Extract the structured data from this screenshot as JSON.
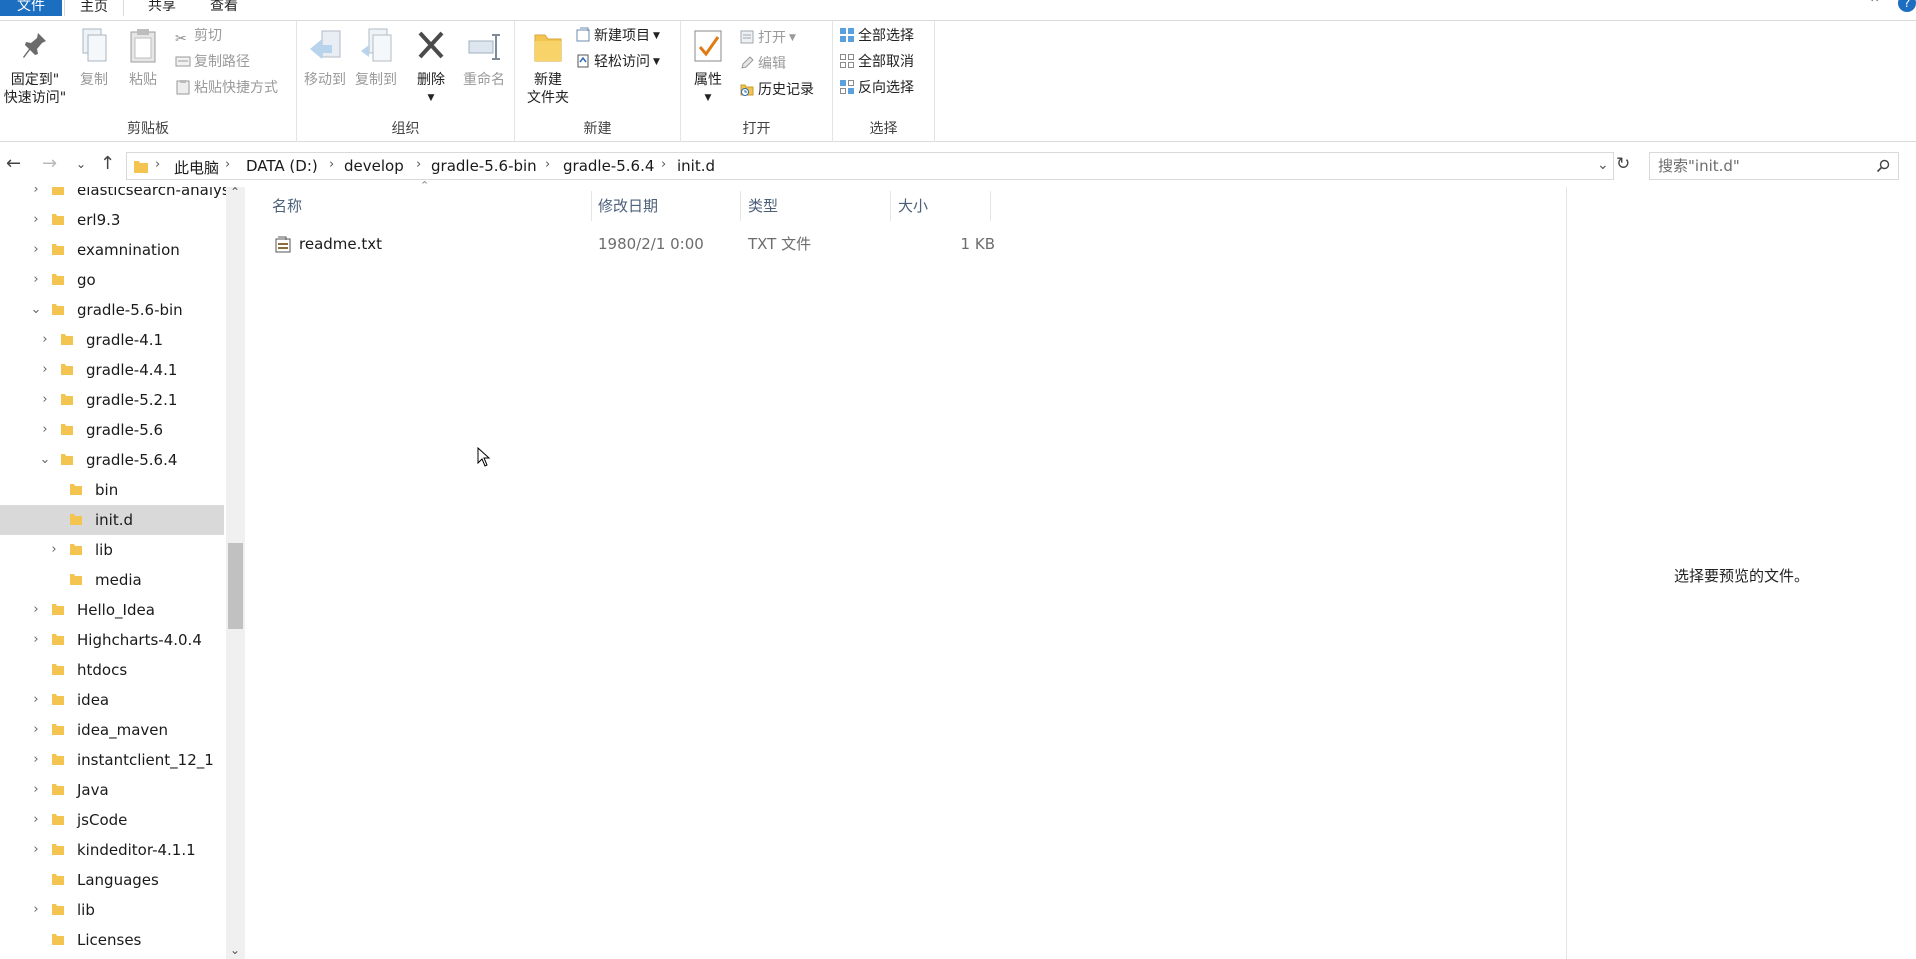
{
  "tabs": {
    "file": "文件",
    "home": "主页",
    "share": "共享",
    "view": "查看"
  },
  "ribbon": {
    "clipboard": {
      "label": "剪贴板",
      "pin_line1": "固定到\"",
      "pin_line2": "快速访问\"",
      "copy": "复制",
      "paste": "粘贴",
      "cut": "剪切",
      "copy_path": "复制路径",
      "paste_shortcut": "粘贴快捷方式"
    },
    "organize": {
      "label": "组织",
      "move_to": "移动到",
      "copy_to": "复制到",
      "delete": "删除",
      "rename": "重命名"
    },
    "new": {
      "label": "新建",
      "new_folder_line1": "新建",
      "new_folder_line2": "文件夹",
      "new_item": "新建项目",
      "easy_access": "轻松访问"
    },
    "open": {
      "label": "打开",
      "properties": "属性",
      "open": "打开",
      "edit": "编辑",
      "history": "历史记录"
    },
    "select": {
      "label": "选择",
      "select_all": "全部选择",
      "select_none": "全部取消",
      "invert": "反向选择"
    }
  },
  "address": {
    "crumbs": [
      "此电脑",
      "DATA (D:)",
      "develop",
      "gradle-5.6-bin",
      "gradle-5.6.4",
      "init.d"
    ]
  },
  "search": {
    "placeholder": "搜索\"init.d\""
  },
  "tree": [
    {
      "label": "elasticsearch-analysi",
      "chevron": "›"
    },
    {
      "label": "erl9.3",
      "chevron": "›"
    },
    {
      "label": "examnination",
      "chevron": "›"
    },
    {
      "label": "go",
      "chevron": "›"
    },
    {
      "label": "gradle-5.6-bin",
      "chevron": "⌄"
    },
    {
      "label": "gradle-4.1",
      "chevron": "›"
    },
    {
      "label": "gradle-4.4.1",
      "chevron": "›"
    },
    {
      "label": "gradle-5.2.1",
      "chevron": "›"
    },
    {
      "label": "gradle-5.6",
      "chevron": "›"
    },
    {
      "label": "gradle-5.6.4",
      "chevron": "⌄"
    },
    {
      "label": "bin",
      "chevron": ""
    },
    {
      "label": "init.d",
      "chevron": ""
    },
    {
      "label": "lib",
      "chevron": "›"
    },
    {
      "label": "media",
      "chevron": ""
    },
    {
      "label": "Hello_Idea",
      "chevron": "›"
    },
    {
      "label": "Highcharts-4.0.4",
      "chevron": "›"
    },
    {
      "label": "htdocs",
      "chevron": ""
    },
    {
      "label": "idea",
      "chevron": "›"
    },
    {
      "label": "idea_maven",
      "chevron": "›"
    },
    {
      "label": "instantclient_12_1",
      "chevron": "›"
    },
    {
      "label": "Java",
      "chevron": "›"
    },
    {
      "label": "jsCode",
      "chevron": "›"
    },
    {
      "label": "kindeditor-4.1.1",
      "chevron": "›"
    },
    {
      "label": "Languages",
      "chevron": ""
    },
    {
      "label": "lib",
      "chevron": "›"
    },
    {
      "label": "Licenses",
      "chevron": ""
    }
  ],
  "columns": {
    "name": "名称",
    "modified": "修改日期",
    "type": "类型",
    "size": "大小"
  },
  "files": [
    {
      "name": "readme.txt",
      "modified": "1980/2/1 0:00",
      "type": "TXT 文件",
      "size": "1 KB"
    }
  ],
  "preview": {
    "message": "选择要预览的文件。"
  },
  "colors": {
    "accent": "#1c6fc0",
    "selected": "#d9d9d9",
    "folder": "#f3c44f",
    "header_text": "#4c607a"
  },
  "icons": [
    "pin-icon",
    "copy-icon",
    "paste-icon",
    "cut-icon",
    "copy-path-icon",
    "paste-shortcut-icon",
    "move-to-icon",
    "copy-to-icon",
    "delete-icon",
    "rename-icon",
    "new-folder-icon",
    "new-item-icon",
    "easy-access-icon",
    "properties-icon",
    "open-icon",
    "edit-icon",
    "history-icon",
    "select-all-icon",
    "select-none-icon",
    "invert-selection-icon",
    "back-icon",
    "forward-icon",
    "recent-icon",
    "up-icon",
    "refresh-icon",
    "search-icon",
    "folder-icon",
    "text-file-icon"
  ]
}
